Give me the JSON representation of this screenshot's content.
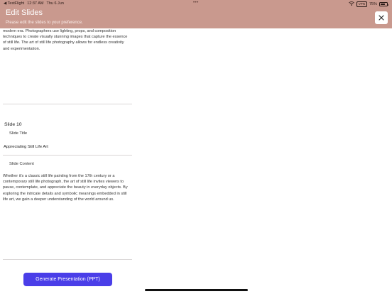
{
  "status_bar": {
    "carrier": "◀ TestFlight",
    "time": "12:37 AM",
    "date": "Thu 6 Jun",
    "dots": "•••",
    "vpn": "VPN",
    "battery": "75%",
    "battery_level": 0.75
  },
  "header": {
    "title": "Edit Slides",
    "subtitle": "Please edit the slides to your preference.",
    "close_icon": "close-icon"
  },
  "prev_slide": {
    "content_text": "modern era. Photographers use lighting, props, and composition techniques to create visually stunning images that capture the essence of still life. The art of still life photography allows for endless creativity and experimentation."
  },
  "slide": {
    "heading_prefix": "Slide",
    "number": "10",
    "title_label": "Slide Title",
    "title_value": "Appreciating Still Life Art",
    "content_label": "Slide Content",
    "content_value": "Whether it's a classic still life painting from the 17th century or a contemporary still life photograph, the art of still life invites viewers to pause, contemplate, and appreciate the beauty in everyday objects. By exploring the intricate details and symbolic meanings embedded in still life art, we gain a deeper understanding of the world around us."
  },
  "actions": {
    "generate_label": "Generate Presentation (PPT)"
  },
  "colors": {
    "header_bg": "#c9998e",
    "button_bg": "#4a3ee8"
  }
}
